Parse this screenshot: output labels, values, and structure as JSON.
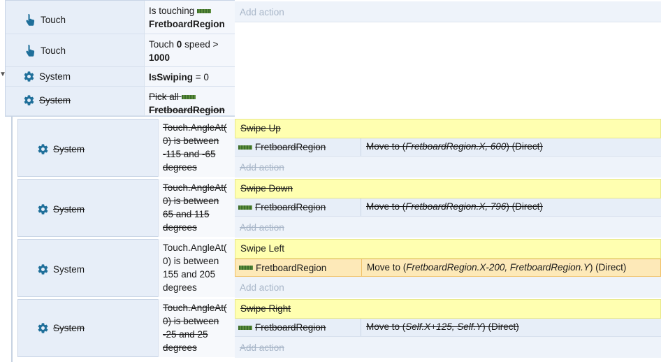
{
  "parent": {
    "conditions": [
      {
        "object": "Touch",
        "icon": "hand-pointer-icon",
        "param_prefix": "Is touching",
        "param_bold": "FretboardRegion",
        "param_suffix": "",
        "disabled": false
      },
      {
        "object": "Touch",
        "icon": "hand-pointer-icon",
        "param_prefix": "Touch",
        "param_bold": "0",
        "param_suffix": "speed >",
        "param_bold2": "1000",
        "disabled": false
      },
      {
        "object": "System",
        "icon": "gear-icon",
        "param_bold": "IsSwiping",
        "param_suffix": "= 0",
        "disabled": false
      },
      {
        "object": "System",
        "icon": "gear-icon",
        "param_prefix": "Pick all",
        "param_bold": "FretboardRegion",
        "disabled": true
      }
    ],
    "add_action": "Add action"
  },
  "subevents": [
    {
      "object": "System",
      "condition": "Touch.AngleAt( 0) is between -115 and -65 degrees",
      "comment": "Swipe Up",
      "action_object": "FretboardRegion",
      "action_prefix": "Move to (",
      "action_italic": "FretboardRegion.X, 600",
      "action_suffix": ") (Direct)",
      "add_action": "Add action",
      "disabled": true,
      "highlight": false
    },
    {
      "object": "System",
      "condition": "Touch.AngleAt( 0) is between 65 and 115 degrees",
      "comment": "Swipe Down",
      "action_object": "FretboardRegion",
      "action_prefix": "Move to (",
      "action_italic": "FretboardRegion.X, 796",
      "action_suffix": ") (Direct)",
      "add_action": "Add action",
      "disabled": true,
      "highlight": false
    },
    {
      "object": "System",
      "condition": "Touch.AngleAt( 0) is between 155 and 205 degrees",
      "comment": "Swipe Left",
      "action_object": "FretboardRegion",
      "action_prefix": "Move to (",
      "action_italic": "FretboardRegion.X-200, FretboardRegion.Y",
      "action_suffix": ") (Direct)",
      "add_action": "Add action",
      "disabled": false,
      "highlight": true
    },
    {
      "object": "System",
      "condition": "Touch.AngleAt( 0) is between -25 and 25 degrees",
      "comment": "Swipe Right",
      "action_object": "FretboardRegion",
      "action_prefix": "Move to (",
      "action_italic": "Self.X+125, Self.Y",
      "action_suffix": ") (Direct)",
      "add_action": "Add action",
      "disabled": true,
      "highlight": false
    }
  ],
  "colors": {
    "comment_bg": "#ffffb0",
    "event_bg": "#e7eef8",
    "highlight_bg": "#fde9b8",
    "icon": "#1f6f9a"
  }
}
